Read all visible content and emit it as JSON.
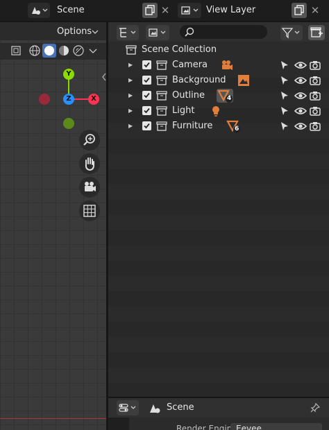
{
  "topbar": {
    "scene_icon": "scene-icon",
    "scene_name": "Scene",
    "view_layer_icon": "render-layers-icon",
    "view_layer_name": "View Layer"
  },
  "viewport": {
    "options_label": "Options",
    "gizmo": {
      "y": "Y",
      "z": "Z",
      "x": "X"
    },
    "nav_icons": [
      "zoom-icon",
      "hand-pan-icon",
      "camera-icon",
      "grid-icon"
    ]
  },
  "outliner": {
    "search_placeholder": "",
    "root": "Scene Collection",
    "rows": [
      {
        "label": "Camera",
        "icon": "camera-object-icon",
        "badge": ""
      },
      {
        "label": "Background",
        "icon": "image-icon",
        "badge": ""
      },
      {
        "label": "Outline",
        "icon": "gp-stroke-icon",
        "badge": "4"
      },
      {
        "label": "Light",
        "icon": "light-bulb-icon",
        "badge": ""
      },
      {
        "label": "Furniture",
        "icon": "gp-stroke-icon",
        "badge": "6"
      }
    ]
  },
  "properties": {
    "title": "Scene",
    "partial_label": "Render Engine",
    "partial_value": "Eevee"
  },
  "colors": {
    "accent_orange": "#e07e3c",
    "axis_x": "#ff3352",
    "axis_y": "#8bdc00",
    "axis_z": "#2890ff"
  }
}
